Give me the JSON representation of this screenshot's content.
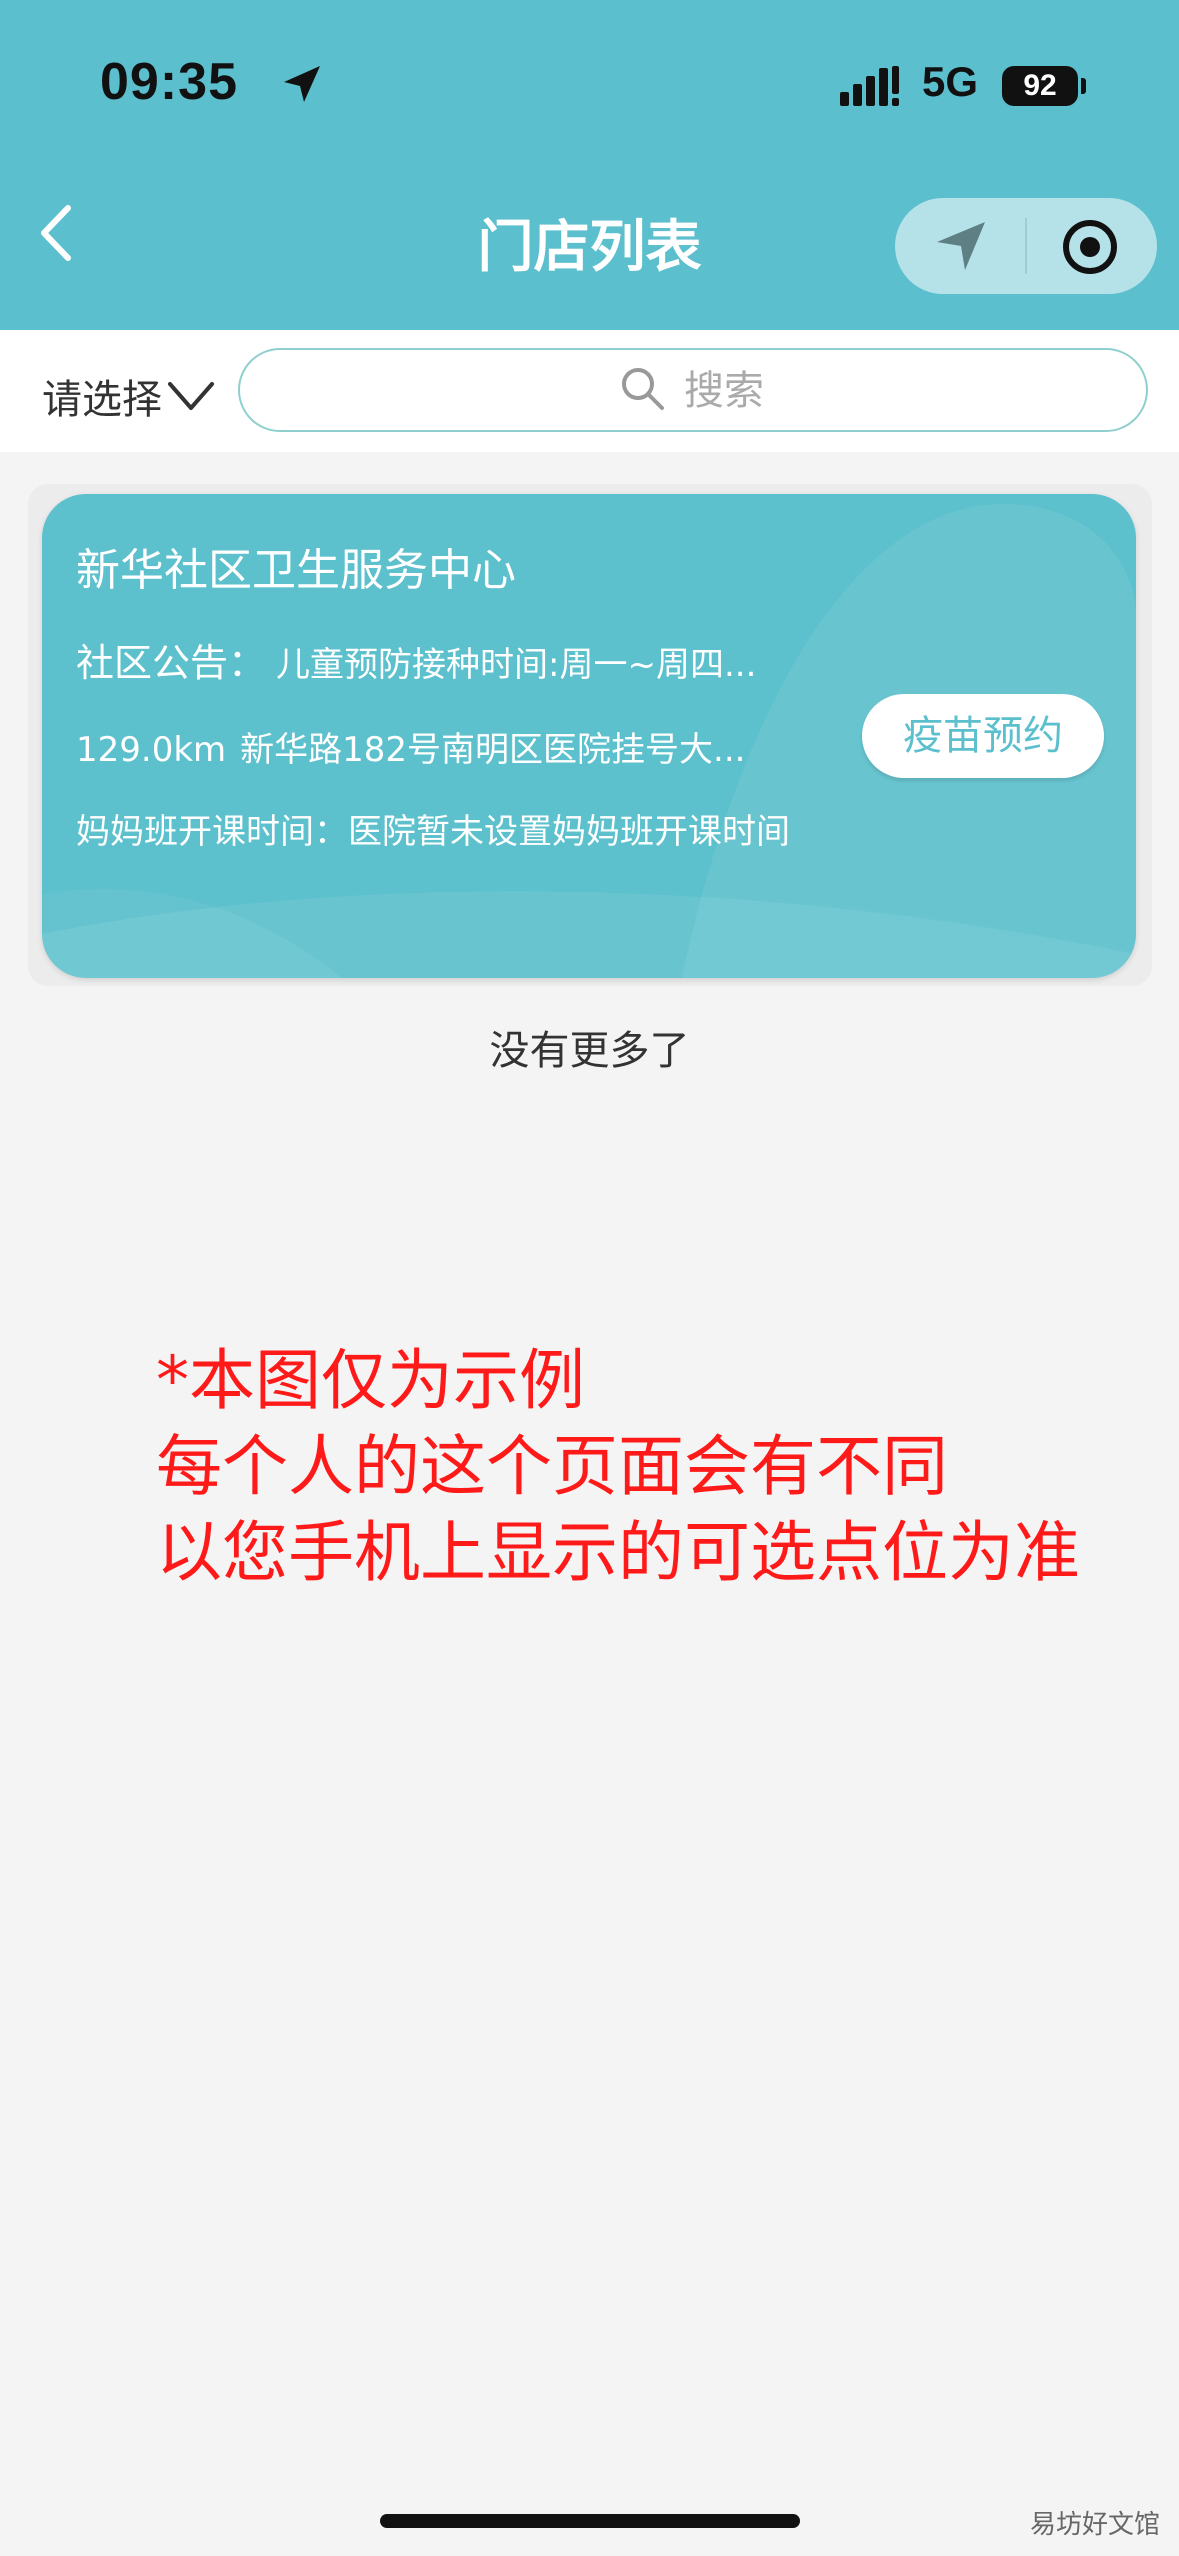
{
  "status_bar": {
    "time": "09:35",
    "network": "5G",
    "battery": "92"
  },
  "header": {
    "title": "门店列表"
  },
  "filter": {
    "select_label": "请选择",
    "search_placeholder": "搜索"
  },
  "store_card": {
    "name": "新华社区卫生服务中心",
    "notice_label": "社区公告：",
    "notice_text": "儿童预防接种时间:周一~周四...",
    "distance": "129.0km",
    "address": "新华路182号南明区医院挂号大...",
    "mom_class_label": "妈妈班开课时间：",
    "mom_class_value": "医院暂未设置妈妈班开课时间",
    "action_label": "疫苗预约"
  },
  "list_footer": "没有更多了",
  "annotation": {
    "lines": [
      "*本图仅为示例",
      "每个人的这个页面会有不同",
      "以您手机上显示的可选点位为准"
    ]
  },
  "watermark": "易坊好文馆",
  "colors": {
    "header_bg": "#5bbfce",
    "card_bg": "#5cc0cd",
    "annotation_red": "#ff1a1a",
    "page_bg": "#f4f4f4"
  }
}
